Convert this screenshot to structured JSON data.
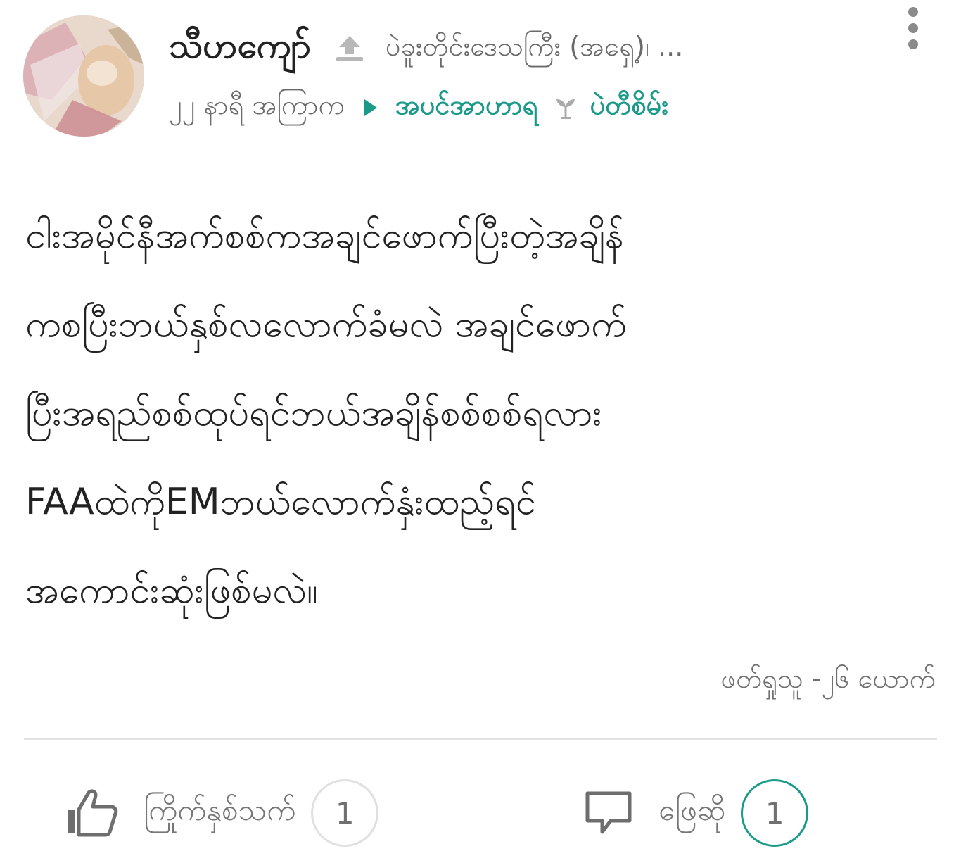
{
  "post": {
    "author": "သီဟကျော်",
    "location": "ပဲခူးတိုင်းဒေသကြီး (အရှေ့)၊ ...",
    "time_ago": "၂၂ နာရီ အကြာက",
    "category": "အပင်အာဟာရ",
    "subcategory": "ပဲတီစိမ်း",
    "body": [
      "ငါးအမိုင်နီအက်စစ်ကအချင်ဖောက်ပြီးတဲ့အချိန်",
      "ကစပြီးဘယ်နှစ်လလောက်ခံမလဲ အချင်ဖောက်",
      "ပြီးအရည်စစ်ထုပ်ရင်ဘယ်အချိန်စစ်စစ်ရလား",
      "FAAထဲကိုEMဘယ်လောက်နှံးထည့်ရင်",
      "အကောင်းဆုံးဖြစ်မလဲ။"
    ],
    "followers": "ဖတ်ရှုသူ -၂၆ ယောက်"
  },
  "actions": {
    "like_label": "ကြိုက်နှစ်သက်",
    "like_count": "1",
    "comment_label": "ဖြေဆို",
    "comment_count": "1"
  },
  "colors": {
    "accent": "#1b9a8a",
    "muted": "#707070",
    "divider": "#e2e2e2"
  },
  "icons": {
    "share": "share-up-icon",
    "arrow": "play-arrow-icon",
    "plant": "plant-icon",
    "menu": "more-vertical-icon",
    "like": "thumbs-up-icon",
    "comment": "speech-bubble-icon"
  }
}
